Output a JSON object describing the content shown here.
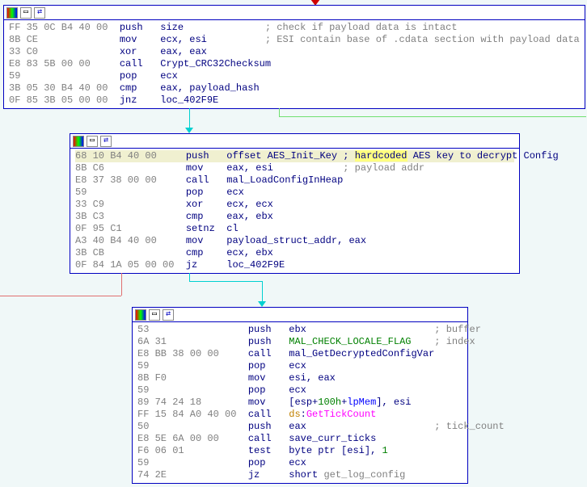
{
  "colors": {
    "accent": "#0000c0",
    "hex": "#808080",
    "num": "#008000",
    "api": "#ff00ff",
    "highlight": "#ffff80"
  },
  "node1": {
    "rows": [
      {
        "hex": "FF 35 0C B4 40 00",
        "mn": "push",
        "ops": "size",
        "cmt": "; check if payload data is intact"
      },
      {
        "hex": "8B CE",
        "mn": "mov",
        "ops": "ecx, esi",
        "cmt": "; ESI contain base of .cdata section with payload data"
      },
      {
        "hex": "33 C0",
        "mn": "xor",
        "ops": "eax, eax",
        "cmt": ""
      },
      {
        "hex": "E8 83 5B 00 00",
        "mn": "call",
        "ops": "Crypt_CRC32Checksum",
        "cmt": ""
      },
      {
        "hex": "59",
        "mn": "pop",
        "ops": "ecx",
        "cmt": ""
      },
      {
        "hex": "3B 05 30 B4 40 00",
        "mn": "cmp",
        "ops": "eax, payload_hash",
        "cmt": ""
      },
      {
        "hex": "0F 85 3B 05 00 00",
        "mn": "jnz",
        "ops": "loc_402F9E",
        "cmt": ""
      }
    ]
  },
  "node2": {
    "rows": [
      {
        "hex": "68 10 B4 40 00",
        "mn": "push",
        "ops_prefix": "offset AES_Init_Key ; ",
        "hl": "hardcoded",
        "ops_suffix": " AES key to decrypt Config"
      },
      {
        "hex": "8B C6",
        "mn": "mov",
        "ops": "eax, esi",
        "cmt": "; payload addr"
      },
      {
        "hex": "E8 37 38 00 00",
        "mn": "call",
        "ops": "mal_LoadConfigInHeap",
        "cmt": ""
      },
      {
        "hex": "59",
        "mn": "pop",
        "ops": "ecx",
        "cmt": ""
      },
      {
        "hex": "33 C9",
        "mn": "xor",
        "ops": "ecx, ecx",
        "cmt": ""
      },
      {
        "hex": "3B C3",
        "mn": "cmp",
        "ops": "eax, ebx",
        "cmt": ""
      },
      {
        "hex": "0F 95 C1",
        "mn": "setnz",
        "ops": "cl",
        "cmt": ""
      },
      {
        "hex": "A3 40 B4 40 00",
        "mn": "mov",
        "ops": "payload_struct_addr, eax",
        "cmt": ""
      },
      {
        "hex": "3B CB",
        "mn": "cmp",
        "ops": "ecx, ebx",
        "cmt": ""
      },
      {
        "hex": "0F 84 1A 05 00 00",
        "mn": "jz",
        "ops": "loc_402F9E",
        "cmt": ""
      }
    ]
  },
  "node3": {
    "rows": [
      {
        "hex": "53",
        "mn": "push",
        "ops": "ebx",
        "cmt": "; buffer"
      },
      {
        "hex": "6A 31",
        "mn": "push",
        "ops": "MAL_CHECK_LOCALE_FLAG",
        "opsClass": "num",
        "cmt": "; index"
      },
      {
        "hex": "E8 BB 38 00 00",
        "mn": "call",
        "ops": "mal_GetDecryptedConfigVar",
        "cmt": ""
      },
      {
        "hex": "59",
        "mn": "pop",
        "ops": "ecx",
        "cmt": ""
      },
      {
        "hex": "8B F0",
        "mn": "mov",
        "ops": "esi, eax",
        "cmt": ""
      },
      {
        "hex": "59",
        "mn": "pop",
        "ops": "ecx",
        "cmt": ""
      },
      {
        "hex": "89 74 24 18",
        "mn": "mov",
        "ops_html": "[esp+<span class=\"num\">100h</span>+<span class=\"symlink\">lpMem</span>], esi",
        "cmt": ""
      },
      {
        "hex": "FF 15 84 A0 40 00",
        "mn": "call",
        "ops_html": "<span class=\"ds\">ds</span>:<span class=\"api\">GetTickCount</span>",
        "cmt": ""
      },
      {
        "hex": "50",
        "mn": "push",
        "ops": "eax",
        "cmt": "; tick_count"
      },
      {
        "hex": "E8 5E 6A 00 00",
        "mn": "call",
        "ops": "save_curr_ticks",
        "cmt": ""
      },
      {
        "hex": "F6 06 01",
        "mn": "test",
        "ops_html": "<span class=\"kw\">byte ptr</span> [esi], <span class=\"num\">1</span>",
        "cmt": ""
      },
      {
        "hex": "59",
        "mn": "pop",
        "ops": "ecx",
        "cmt": ""
      },
      {
        "hex": "74 2E",
        "mn": "jz",
        "ops_html": "<span class=\"kw\">short</span> <span class=\"hex\">get_log_config</span>",
        "cmt": ""
      }
    ]
  },
  "icons": {
    "colors": "colors-icon",
    "window": "window-icon",
    "swap": "swap-icon"
  }
}
